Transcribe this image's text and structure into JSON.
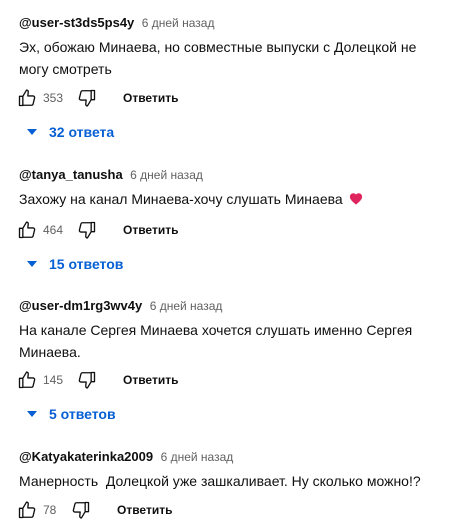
{
  "colors": {
    "link_blue": "#065fd4",
    "muted_gray": "#606060",
    "text": "#0f0f0f",
    "heart_red": "#e0245e"
  },
  "icons": {
    "like": "thumbs-up-outline-icon",
    "dislike": "thumbs-down-outline-icon",
    "replies_toggle": "caret-down-icon",
    "emoji": "red-heart-icon"
  },
  "comments": [
    {
      "author": "@user-st3ds5ps4y",
      "time": "6 дней назад",
      "text": "Эх, обожаю Минаева, но совместные выпуски с Долецкой не могу смотреть",
      "likes": "353",
      "reply_label": "Ответить",
      "replies_label": "32 ответа"
    },
    {
      "author": "@tanya_tanusha",
      "time": "6 дней назад",
      "text": "Захожу на канал Минаева-хочу слушать Минаева",
      "likes": "464",
      "reply_label": "Ответить",
      "replies_label": "15 ответов"
    },
    {
      "author": "@user-dm1rg3wv4y",
      "time": "6 дней назад",
      "text": "На канале Сергея Минаева хочется слушать именно Сергея Минаева.",
      "likes": "145",
      "reply_label": "Ответить",
      "replies_label": "5 ответов"
    },
    {
      "author": "@Katyakaterinka2009",
      "time": "6 дней назад",
      "text": "Манерность  Долецкой уже зашкаливает. Ну сколько можно!?",
      "likes": "78",
      "reply_label": "Ответить"
    }
  ]
}
